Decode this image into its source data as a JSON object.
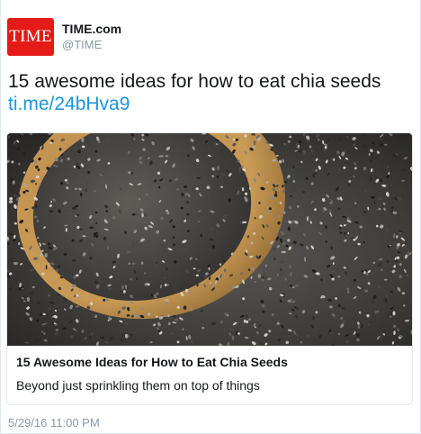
{
  "author": {
    "avatar_text": "TIME",
    "display_name": "TIME.com",
    "handle": "@TIME"
  },
  "tweet": {
    "text": "15 awesome ideas for how to eat chia seeds",
    "link_text": "ti.me/24bHva9",
    "timestamp": "5/29/16 11:00 PM"
  },
  "card": {
    "image_icon": "chia-seeds-photo",
    "title": "15 Awesome Ideas for How to Eat Chia Seeds",
    "description": "Beyond just sprinkling them on top of things"
  },
  "colors": {
    "brand_red": "#e41b17",
    "link_blue": "#1b95e0",
    "muted_gray": "#8899a6",
    "border": "#e1e8ed"
  }
}
